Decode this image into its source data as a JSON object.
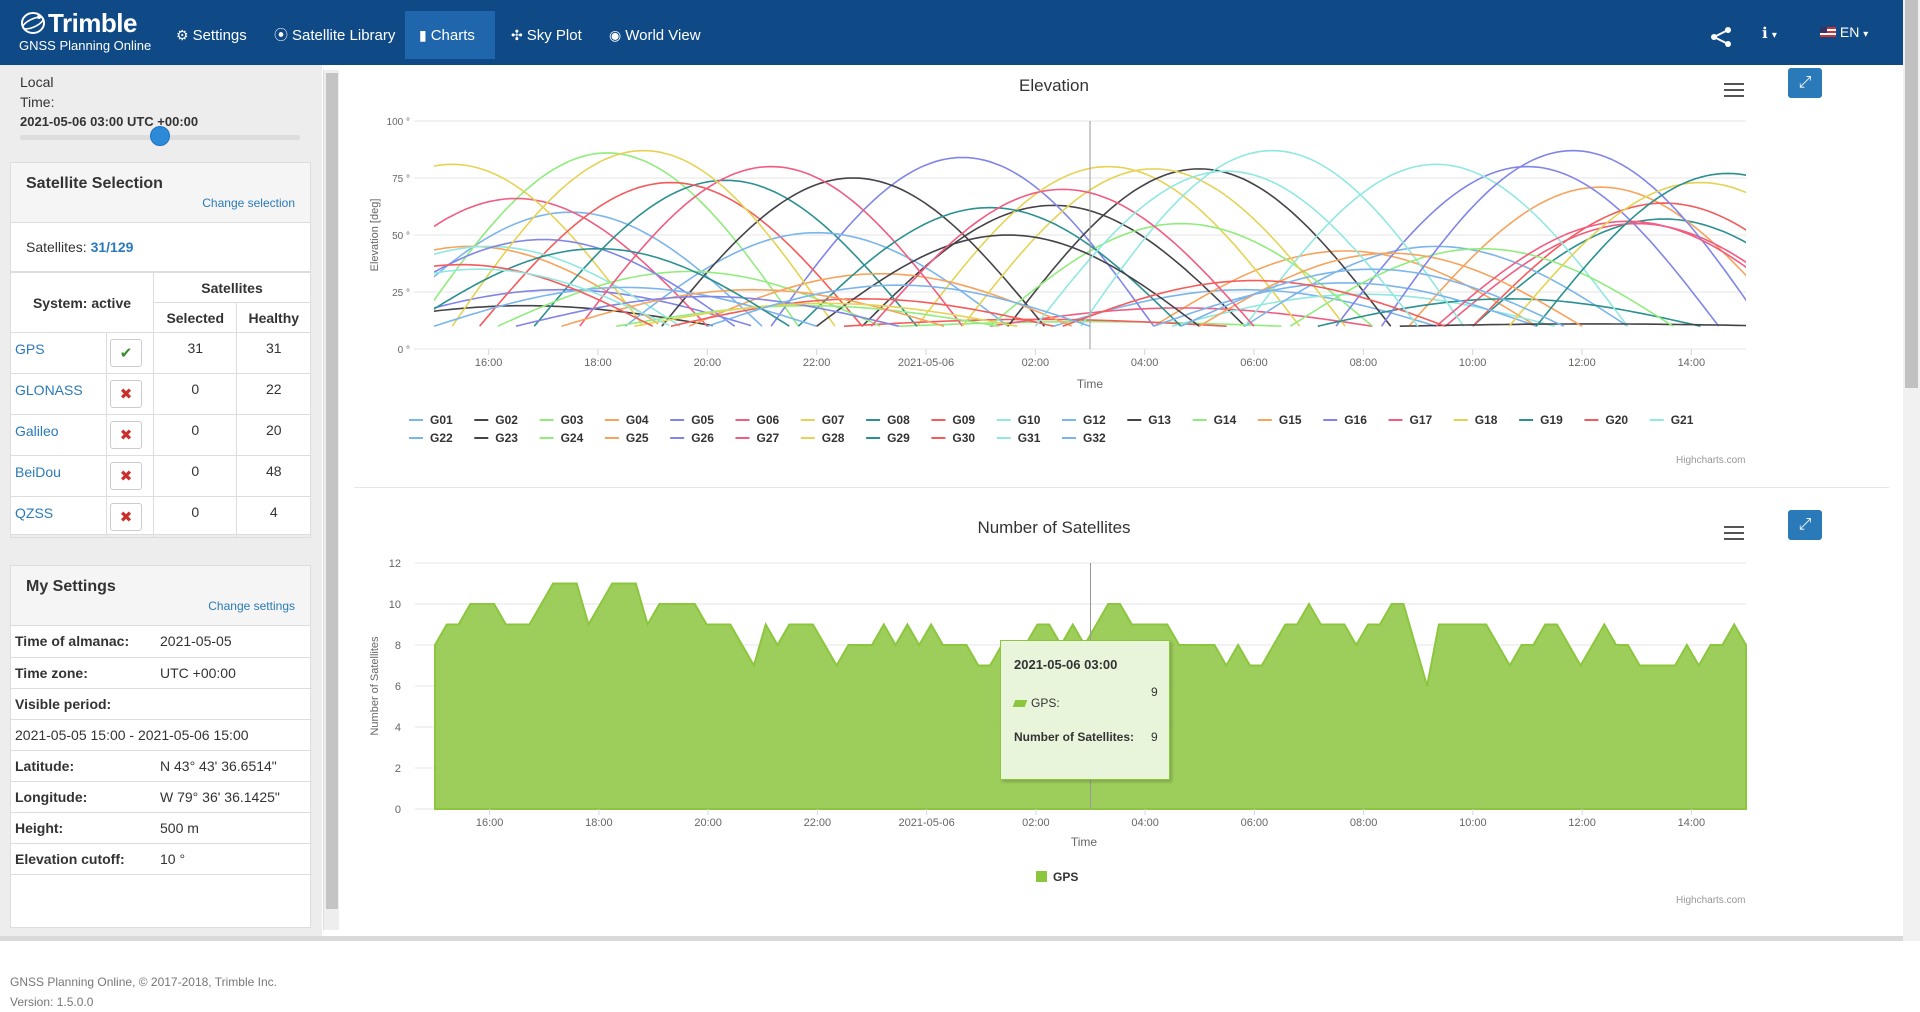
{
  "header": {
    "brand": "Trimble",
    "subtitle": "GNSS Planning Online",
    "nav": [
      {
        "label": "Settings",
        "icon": "gear-icon"
      },
      {
        "label": "Satellite Library",
        "icon": "target-icon"
      },
      {
        "label": "Charts",
        "icon": "bar-chart-icon",
        "active": true
      },
      {
        "label": "Sky Plot",
        "icon": "satellite-icon"
      },
      {
        "label": "World View",
        "icon": "globe-icon"
      }
    ],
    "lang": "EN"
  },
  "sidebar": {
    "local_time_label": "Local",
    "time_label": "Time:",
    "time_value": "2021-05-06 03:00 UTC +00:00",
    "slider_fraction": 0.5,
    "selection": {
      "title": "Satellite Selection",
      "change_link": "Change selection",
      "satellites_label": "Satellites:",
      "satellites_value": "31/129",
      "col_system": "System: active",
      "col_satellites": "Satellites",
      "col_selected": "Selected",
      "col_healthy": "Healthy",
      "rows": [
        {
          "system": "GPS",
          "active": true,
          "selected": "31",
          "healthy": "31"
        },
        {
          "system": "GLONASS",
          "active": false,
          "selected": "0",
          "healthy": "22"
        },
        {
          "system": "Galileo",
          "active": false,
          "selected": "0",
          "healthy": "20"
        },
        {
          "system": "BeiDou",
          "active": false,
          "selected": "0",
          "healthy": "48"
        },
        {
          "system": "QZSS",
          "active": false,
          "selected": "0",
          "healthy": "4"
        }
      ]
    },
    "settings": {
      "title": "My Settings",
      "change_link": "Change settings",
      "rows": [
        {
          "k": "Time of almanac:",
          "v": "2021-05-05"
        },
        {
          "k": "Time zone:",
          "v": "UTC +00:00"
        },
        {
          "k": "Visible period:",
          "v": ""
        },
        {
          "k": "2021-05-05 15:00 - 2021-05-06 15:00",
          "v": ""
        },
        {
          "k": "Latitude:",
          "v": "N 43° 43' 36.6514\""
        },
        {
          "k": "Longitude:",
          "v": "W 79° 36' 36.1425\""
        },
        {
          "k": "Height:",
          "v": "500 m"
        },
        {
          "k": "Elevation cutoff:",
          "v": "10 °"
        }
      ]
    },
    "footer": "GNSS Planning Online, © 2017-2018, Trimble Inc.",
    "version": "Version: 1.5.0.0"
  },
  "chart_data": [
    {
      "type": "line",
      "title": "Elevation",
      "xlabel": "Time",
      "ylabel": "Elevation [deg]",
      "ylim": [
        0,
        100
      ],
      "yticks": [
        "0 °",
        "25 °",
        "50 °",
        "75 °",
        "100 °"
      ],
      "xticks": [
        "16:00",
        "18:00",
        "20:00",
        "22:00",
        "2021-05-06",
        "02:00",
        "04:00",
        "06:00",
        "08:00",
        "10:00",
        "12:00",
        "14:00"
      ],
      "x_range": [
        "2021-05-05 15:00",
        "2021-05-06 15:00"
      ],
      "cursor": "2021-05-06 03:00",
      "series_names": [
        "G01",
        "G02",
        "G03",
        "G04",
        "G05",
        "G06",
        "G07",
        "G08",
        "G09",
        "G10",
        "G12",
        "G13",
        "G14",
        "G15",
        "G16",
        "G17",
        "G18",
        "G19",
        "G20",
        "G21",
        "G22",
        "G23",
        "G24",
        "G25",
        "G26",
        "G27",
        "G28",
        "G29",
        "G30",
        "G31",
        "G32"
      ],
      "passes": [
        {
          "name": "G01",
          "peaks": [
            [
              "2021-05-05 17:30",
              60
            ],
            [
              "2021-05-06 05:50",
              26
            ]
          ]
        },
        {
          "name": "G02",
          "peaks": [
            [
              "2021-05-05 16:40",
              19
            ],
            [
              "2021-05-06 02:20",
              63
            ]
          ]
        },
        {
          "name": "G03",
          "peaks": [
            [
              "2021-05-05 18:10",
              86
            ],
            [
              "2021-05-06 03:00",
              12
            ]
          ]
        },
        {
          "name": "G04",
          "peaks": [
            [
              "2021-05-05 15:40",
              45
            ],
            [
              "2021-05-06 07:40",
              43
            ]
          ]
        },
        {
          "name": "G05",
          "peaks": [
            [
              "2021-05-05 17:20",
              26
            ],
            [
              "2021-05-06 00:40",
              84
            ]
          ]
        },
        {
          "name": "G06",
          "peaks": [
            [
              "2021-05-05 16:30",
              66
            ],
            [
              "2021-05-06 04:40",
              18
            ]
          ]
        },
        {
          "name": "G07",
          "peaks": [
            [
              "2021-05-05 15:20",
              81
            ],
            [
              "2021-05-06 03:20",
              80
            ]
          ]
        },
        {
          "name": "G08",
          "peaks": [
            [
              "2021-05-05 20:20",
              74
            ],
            [
              "2021-05-06 13:30",
              57
            ]
          ]
        },
        {
          "name": "G09",
          "peaks": [
            [
              "2021-05-05 19:20",
              73
            ],
            [
              "2021-05-06 02:00",
              13
            ]
          ]
        },
        {
          "name": "G10",
          "peaks": [
            [
              "2021-05-05 16:00",
              45
            ],
            [
              "2021-05-06 08:00",
              24
            ]
          ]
        },
        {
          "name": "G12",
          "peaks": [
            [
              "2021-05-05 22:00",
              51
            ],
            [
              "2021-05-06 09:20",
              45
            ]
          ]
        },
        {
          "name": "G13",
          "peaks": [
            [
              "2021-05-05 22:40",
              75
            ],
            [
              "2021-05-06 05:00",
              79
            ]
          ]
        },
        {
          "name": "G14",
          "peaks": [
            [
              "2021-05-05 19:40",
              34
            ],
            [
              "2021-05-06 04:40",
              55
            ]
          ]
        },
        {
          "name": "G15",
          "peaks": [
            [
              "2021-05-05 23:10",
              33
            ],
            [
              "2021-05-06 12:20",
              71
            ]
          ]
        },
        {
          "name": "G16",
          "peaks": [
            [
              "2021-05-05 17:00",
              48
            ],
            [
              "2021-05-06 11:00",
              80
            ]
          ]
        },
        {
          "name": "G17",
          "peaks": [
            [
              "2021-05-05 21:10",
              80
            ],
            [
              "2021-05-06 13:00",
              55
            ]
          ]
        },
        {
          "name": "G18",
          "peaks": [
            [
              "2021-05-05 18:50",
              87
            ],
            [
              "2021-05-06 04:10",
              79
            ]
          ]
        },
        {
          "name": "G19",
          "peaks": [
            [
              "2021-05-06 01:10",
              62
            ],
            [
              "2021-05-06 10:40",
              22
            ]
          ]
        },
        {
          "name": "G20",
          "peaks": [
            [
              "2021-05-05 22:50",
              22
            ],
            [
              "2021-05-06 13:30",
              64
            ]
          ]
        },
        {
          "name": "G21",
          "peaks": [
            [
              "2021-05-06 06:20",
              87
            ],
            [
              "2021-05-06 09:20",
              81
            ]
          ]
        },
        {
          "name": "G22",
          "peaks": [
            [
              "2021-05-05 18:30",
              27
            ],
            [
              "2021-05-06 07:40",
              29
            ]
          ]
        },
        {
          "name": "G23",
          "peaks": [
            [
              "2021-05-06 01:30",
              50
            ],
            [
              "2021-05-06 12:10",
              11
            ]
          ]
        },
        {
          "name": "G24",
          "peaks": [
            [
              "2021-05-05 21:50",
              19
            ],
            [
              "2021-05-06 10:10",
              44
            ]
          ]
        },
        {
          "name": "G25",
          "peaks": [
            [
              "2021-05-05 20:50",
              26
            ],
            [
              "2021-05-06 08:30",
              42
            ]
          ]
        },
        {
          "name": "G26",
          "peaks": [
            [
              "2021-05-05 20:00",
              23
            ],
            [
              "2021-05-06 11:50",
              87
            ]
          ]
        },
        {
          "name": "G27",
          "peaks": [
            [
              "2021-05-06 02:30",
              70
            ],
            [
              "2021-05-06 12:50",
              56
            ]
          ]
        },
        {
          "name": "G28",
          "peaks": [
            [
              "2021-05-05 22:10",
              20
            ],
            [
              "2021-05-06 14:10",
              73
            ]
          ]
        },
        {
          "name": "G29",
          "peaks": [
            [
              "2021-05-05 18:00",
              44
            ],
            [
              "2021-05-06 14:40",
              77
            ]
          ]
        },
        {
          "name": "G30",
          "peaks": [
            [
              "2021-05-05 15:30",
              37
            ],
            [
              "2021-05-06 06:00",
              30
            ]
          ]
        },
        {
          "name": "G31",
          "peaks": [
            [
              "2021-05-05 15:50",
              35
            ],
            [
              "2021-05-06 05:30",
              78
            ]
          ]
        },
        {
          "name": "G32",
          "peaks": [
            [
              "2021-05-05 23:30",
              28
            ],
            [
              "2021-05-06 08:10",
              35
            ]
          ]
        }
      ],
      "credit": "Highcharts.com"
    },
    {
      "type": "area",
      "title": "Number of Satellites",
      "xlabel": "Time",
      "ylabel": "Number of Satellites",
      "ylim": [
        0,
        12
      ],
      "yticks": [
        "0",
        "2",
        "4",
        "6",
        "8",
        "10",
        "12"
      ],
      "xticks": [
        "16:00",
        "18:00",
        "20:00",
        "22:00",
        "2021-05-06",
        "02:00",
        "04:00",
        "06:00",
        "08:00",
        "10:00",
        "12:00",
        "14:00"
      ],
      "x_range": [
        "2021-05-05 15:00",
        "2021-05-06 15:00"
      ],
      "series": [
        {
          "name": "GPS",
          "color": "#8cc63e",
          "values": [
            8,
            9,
            9,
            10,
            10,
            10,
            9,
            9,
            9,
            10,
            11,
            11,
            11,
            9,
            10,
            11,
            11,
            11,
            9,
            10,
            10,
            10,
            10,
            9,
            9,
            9,
            8,
            7,
            9,
            8,
            9,
            9,
            9,
            8,
            7,
            8,
            8,
            8,
            9,
            8,
            9,
            8,
            9,
            8,
            8,
            8,
            7,
            7,
            8,
            8,
            8,
            9,
            9,
            8,
            9,
            8,
            9,
            10,
            10,
            9,
            9,
            9,
            9,
            8,
            8,
            8,
            8,
            7,
            8,
            7,
            7,
            8,
            9,
            9,
            10,
            9,
            9,
            9,
            8,
            9,
            9,
            10,
            10,
            8,
            6,
            9,
            9,
            9,
            9,
            9,
            8,
            7,
            8,
            8,
            9,
            9,
            8,
            7,
            8,
            9,
            8,
            8,
            7,
            7,
            7,
            7,
            8,
            7,
            8,
            8,
            9,
            8
          ]
        }
      ],
      "tooltip": {
        "title": "2021-05-06 03:00",
        "series": "GPS:",
        "series_value": "9",
        "total_label": "Number of Satellites:",
        "total_value": "9"
      },
      "legend": [
        "GPS"
      ],
      "credit": "Highcharts.com"
    }
  ],
  "colors": {
    "header": "#0f4a86",
    "active_nav": "#1f66ad",
    "link": "#2a7ab9",
    "area": "#8cc63e"
  }
}
